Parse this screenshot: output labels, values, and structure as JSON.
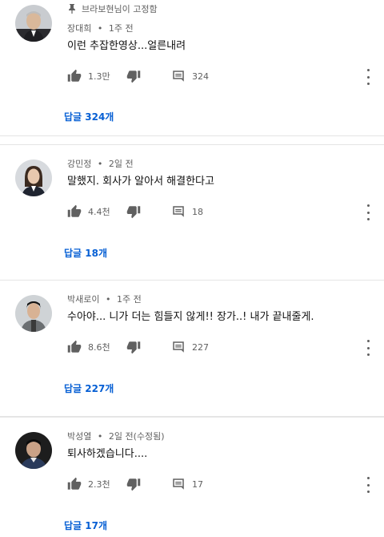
{
  "pinned_label": "브라보현님이 고정함",
  "comments": [
    {
      "author": "장대희",
      "time": "1주 전",
      "text": "이런 추잡한영상...얼른내려",
      "likes": "1.3만",
      "reply_count": "324",
      "replies_label": "답글 324개"
    },
    {
      "author": "강민정",
      "time": "2일 전",
      "text": "말했지. 회사가 알아서 해결한다고",
      "likes": "4.4천",
      "reply_count": "18",
      "replies_label": "답글 18개"
    },
    {
      "author": "박새로이",
      "time": "1주 전",
      "text": "수아야... 니가 더는 힘들지 않게!! 장가..! 내가 끝내줄게.",
      "likes": "8.6천",
      "reply_count": "227",
      "replies_label": "답글 227개"
    },
    {
      "author": "박성열",
      "time": "2일 전(수정됨)",
      "text": "퇴사하겠습니다....",
      "likes": "2.3천",
      "reply_count": "17",
      "replies_label": "답글 17개"
    }
  ],
  "separator": "•",
  "icons": {
    "pin": "pin-icon",
    "like": "thumbs-up-icon",
    "dislike": "thumbs-down-icon",
    "reply": "comment-icon",
    "more": "more-vert-icon"
  },
  "colors": {
    "link": "#065fd4",
    "meta": "#606060",
    "text": "#0f0f0f"
  }
}
